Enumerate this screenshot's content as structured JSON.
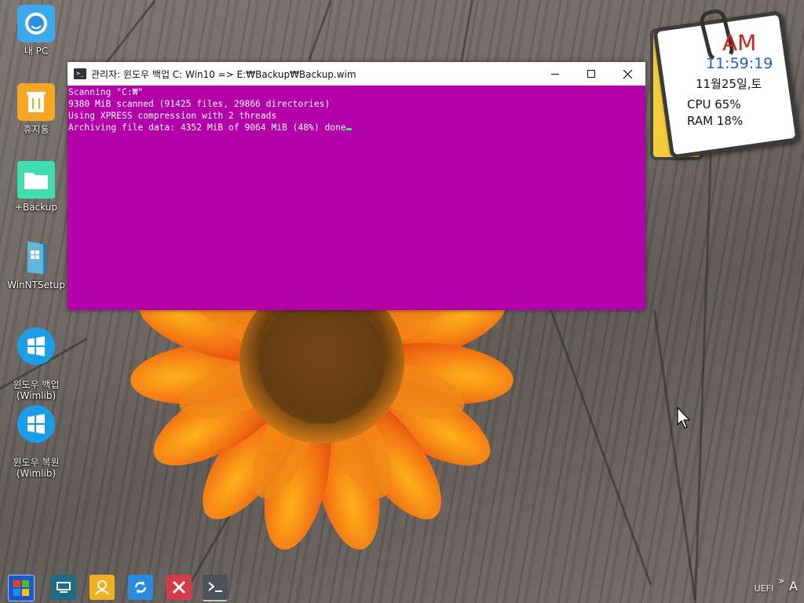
{
  "desktop": {
    "icons": [
      {
        "label": "내 PC"
      },
      {
        "label": "휴지통"
      },
      {
        "label": "+Backup"
      },
      {
        "label": "WinNTSetup"
      },
      {
        "label": "윈도우 백업\n(Wimlib)"
      },
      {
        "label": "윈도우 복원\n(Wimlib)"
      }
    ]
  },
  "console_window": {
    "title": "관리자:  윈도우 백업  C: Win10 => E:₩Backup₩Backup.wim",
    "background_color": "#b400a8",
    "lines": [
      "Scanning \"C:₩\"",
      "9380 MiB scanned (91425 files, 29866 directories)",
      "Using XPRESS compression with 2 threads",
      "Archiving file data: 4352 MiB of 9064 MiB (48%) done"
    ],
    "progress_percent": 48,
    "minimize_icon": "minimize-icon",
    "maximize_icon": "maximize-icon",
    "close_icon": "close-icon"
  },
  "clock_widget": {
    "ampm": "AM",
    "time": "11:59:19",
    "date": "11월25일,토",
    "cpu": "CPU  65%",
    "ram": "RAM  18%"
  },
  "taskbar": {
    "buttons": [
      {
        "icon": "start-icon"
      },
      {
        "icon": "computer-icon"
      },
      {
        "icon": "user-icon"
      },
      {
        "icon": "refresh-icon"
      },
      {
        "icon": "x-app-icon"
      },
      {
        "icon": "terminal-icon"
      }
    ],
    "tray": {
      "boot_mode": "UEFI",
      "expand": "»",
      "ime": "A"
    }
  }
}
